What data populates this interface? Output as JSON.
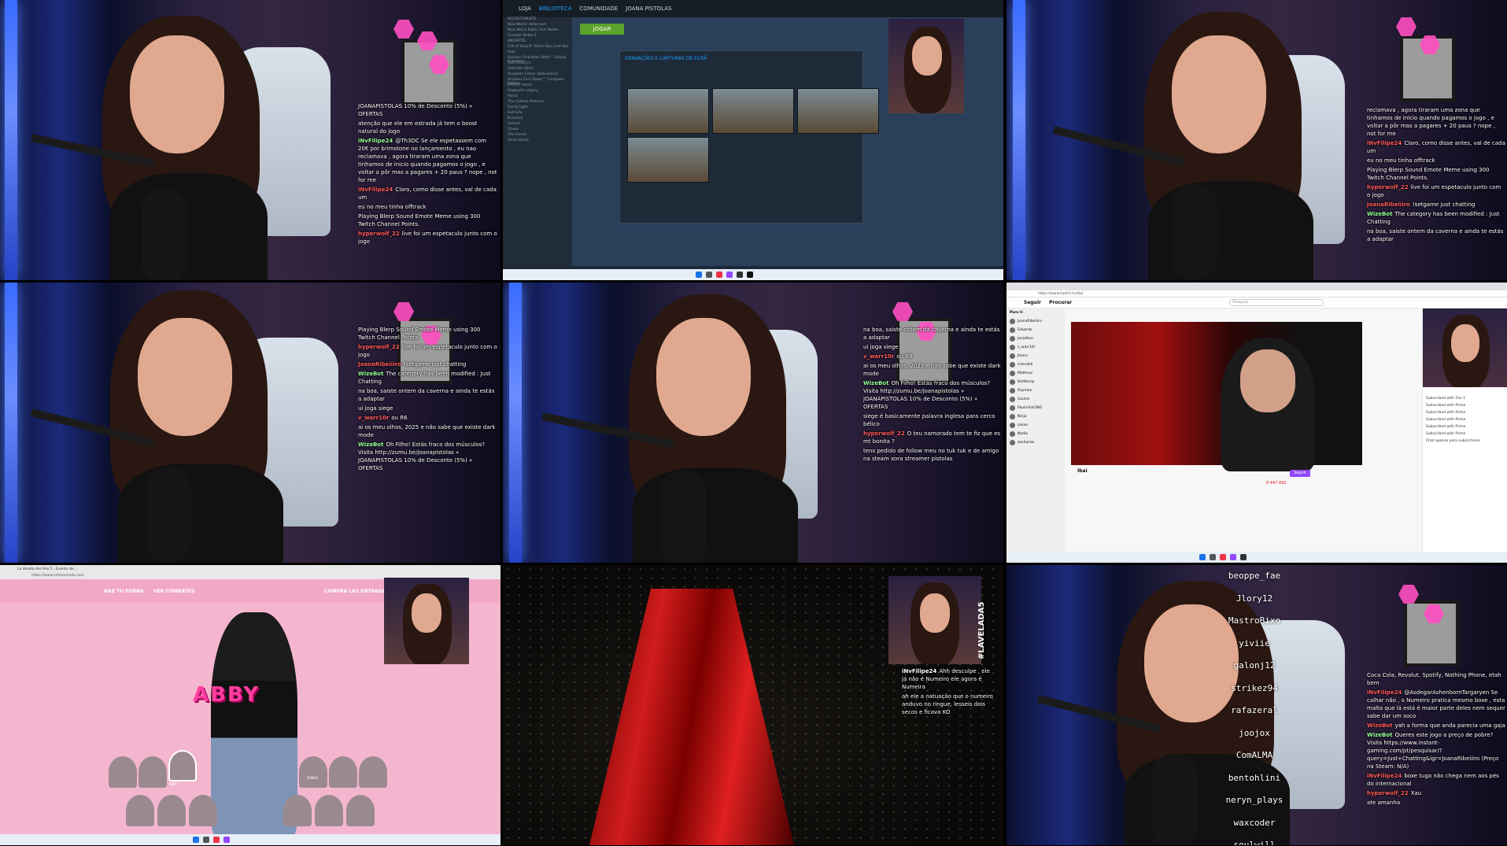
{
  "tile1": {
    "chat": [
      {
        "user": "",
        "text": "JOANAPISTOLAS 10% de Desconto (5%) » OFERTAS",
        "color": "#ffffff"
      },
      {
        "user": "",
        "text": "atenção que ele em estrada já tem o boost natural do jogo",
        "color": "#ff5a5a"
      },
      {
        "user": "iNvFilipe24",
        "text": "@Th3DC Se ele espetassem com 20€ por brimstone no lançamento , eu nao reclamava , agora tiraram uma zona que tinhamos de inicio quando pagamos o jogo , e voltar a pôr mas a pagares + 20 paus ? nope , not for me",
        "color": "#9aff9a"
      },
      {
        "user": "iNvFilipe24",
        "text": "Claro, como disse antes, val de cada um",
        "color": "#ff5a5a"
      },
      {
        "user": "",
        "text": "eu no meu tinha offtrack",
        "color": "#ff5a5a"
      },
      {
        "user": "",
        "text": "Playing Blerp Sound Emote Meme using 300 Twitch Channel Points.",
        "color": "#ff5a5a"
      },
      {
        "user": "hyperwolf_22",
        "text": "live foi um espetaculo junto com o jogo",
        "color": "#ff5a5a"
      }
    ]
  },
  "tile2": {
    "nav": [
      "LOJA",
      "BIBLIOTECA",
      "COMUNIDADE",
      "JOANA PISTOLAS"
    ],
    "play_label": "JOGAR",
    "dialog_title": "GRAVAÇÕES E CAPTURAS DE ECRÃ",
    "sidebar_items": [
      "RECENTEMENTE",
      "New World: Aeternum",
      "New World Public Test Realm",
      "Counter-Strike 2",
      "ANDARTEL",
      "Call of Duty®: Black Ops Cold War",
      "Halo",
      "Horizon Forbidden West™ Edição Complete",
      "Tom Clancy's",
      "Ultimate Ultim",
      "Kingdom Come: Deliverance",
      "Amazon Zero Dawn™ Complete Edition",
      "PAYDAY Home",
      "Hogwarts Legacy",
      "Portal",
      "The Callisto Protocol",
      "Dying Light",
      "Half-Life",
      "Bonanza",
      "Outlast",
      "Ocean",
      "The Forest",
      "Dead Island"
    ]
  },
  "tile3": {
    "chat": [
      {
        "user": "",
        "text": "reclamava , agora tiraram uma zona que tinhamos de inicio quando pagamos o jogo , e voltar a pôr mas a pagares + 20 paus ? nope , not for me",
        "color": "#ffffff"
      },
      {
        "user": "iNvFilipe24",
        "text": "Claro, como disse antes, val de cada um",
        "color": "#ff5a5a"
      },
      {
        "user": "",
        "text": "eu no meu tinha offtrack",
        "color": "#ff5a5a"
      },
      {
        "user": "",
        "text": "Playing Blerp Sound Emote Meme using 300 Twitch Channel Points.",
        "color": "#ff5a5a"
      },
      {
        "user": "hyperwolf_22",
        "text": "live foi um espetaculo junto com o jogo",
        "color": "#ff5a5a"
      },
      {
        "user": "JoanaRibeiiiro",
        "text": "!setgame just chatting",
        "color": "#ff5a5a"
      },
      {
        "user": "WizeBot",
        "text": "The category has been modified : Just Chatting",
        "color": "#9aff9a"
      },
      {
        "user": "",
        "text": "na boa, saiste ontem da caverna e ainda te estás a adaptar",
        "color": "#ff5a5a"
      }
    ]
  },
  "tile4": {
    "chat": [
      {
        "user": "",
        "text": "Playing Blerp Sound Emote Meme using 300 Twitch Channel Points.",
        "color": "#ff5a5a"
      },
      {
        "user": "hyperwolf_22",
        "text": "live foi um espetaculo junto com o jogo",
        "color": "#ff5a5a"
      },
      {
        "user": "JoanaRibeiiiro",
        "text": "!setgame just chatting",
        "color": "#ff5a5a"
      },
      {
        "user": "WizeBot",
        "text": "The category has been modified : Just Chatting",
        "color": "#9aff9a"
      },
      {
        "user": "",
        "text": "na boa, saiste ontem da caverna e ainda te estás a adaptar",
        "color": "#ff5a5a"
      },
      {
        "user": "",
        "text": "ui joga siege",
        "color": "#ff5a5a"
      },
      {
        "user": "v_warr10r",
        "text": "ou R6",
        "color": "#ff5a5a"
      },
      {
        "user": "",
        "text": "ai os meu olhos, 2025 e não sabe que existe dark mode",
        "color": "#ff5a5a"
      },
      {
        "user": "WizeBot",
        "text": "Oh Filho! Estás fraco dos músculos? Visita http://zumu.be/joanapistolas » JOANAPISTOLAS 10% de Desconto (5%) » OFERTAS",
        "color": "#9aff9a"
      }
    ]
  },
  "tile5": {
    "chat": [
      {
        "user": "",
        "text": "na boa, saiste ontem da caverna e ainda te estás a adaptar",
        "color": "#ff5a5a"
      },
      {
        "user": "",
        "text": "ui joga siege",
        "color": "#ff5a5a"
      },
      {
        "user": "v_warr10r",
        "text": "ou R6",
        "color": "#ff5a5a"
      },
      {
        "user": "",
        "text": "ai os meu olhos, 2025 e não sabe que existe dark mode",
        "color": "#ff5a5a"
      },
      {
        "user": "WizeBot",
        "text": "Oh Filho! Estás fraco dos músculos? Visita http://zumu.be/joanapistolas » JOANAPISTOLAS 10% de Desconto (5%) » OFERTAS",
        "color": "#9aff9a"
      },
      {
        "user": "",
        "text": "siege é basicamente palavra inglesa para cerco bélico",
        "color": "#ff5a5a"
      },
      {
        "user": "hyperwolf_22",
        "text": "O teu namorado tem te fiz que es mt bonita ?",
        "color": "#ff5a5a"
      },
      {
        "user": "",
        "text": "tens pedido de follow meu no tuk tuk e de amigo na steam xora streamer pistolas",
        "color": "#ff5a5a"
      }
    ]
  },
  "tile6": {
    "nav": [
      "Seguir",
      "Procurar"
    ],
    "search_placeholder": "Pesquisa",
    "follow_label": "Seguir",
    "streamer": "Ibai",
    "viewers": "8 447 092",
    "section_label": "Para ti",
    "channels": [
      "JoanaRibeiiiro",
      "Eduardo",
      "Jonathan",
      "v_warr10r",
      "Jhoira",
      "sirendell",
      "Matheus",
      "Bottlecap",
      "Rayman",
      "Gaules",
      "PaulinhoLOKO",
      "Ninja",
      "Lekan",
      "Nadia",
      "zacharias"
    ],
    "chat": [
      "Subscribed with Tier 1",
      "Subscribed with Prime",
      "Subscribed with Prime",
      "Subscribed with Prime",
      "Subscribed with Prime",
      "Subscribed with Prime",
      "Chat apenas para subscritores"
    ]
  },
  "tile7": {
    "tab": "La Velada del Año 5 - Evento de ...",
    "url": "https://www.infolavelada.com",
    "menu": [
      "HAZ TU PORRA",
      "VER COMBATES",
      "COMPRA LAS ENTRADAS"
    ],
    "fighter_name": "ABBY",
    "featured": [
      "ABBY",
      "ROBEO"
    ]
  },
  "tile8": {
    "overlay": "#LAVELADA5",
    "chat": [
      {
        "user": "iNvFilipe24",
        "text": "Ahh desculpe , ele já não é Numeiro ele agora é Numeira",
        "color": "#ffffff"
      },
      {
        "user": "",
        "text": "ah ele a natuação que o numeiro anduvo no ringue, lesseis dois secos e ficava KO",
        "color": "#ffffff"
      }
    ]
  },
  "tile9": {
    "names": [
      "beoppe_fae",
      "Jlory12",
      "MastroBixo",
      "yiviie",
      "galonj12",
      "strikez94",
      "rafazeral",
      "joojox",
      "ComALMA",
      "bentohlini",
      "neryn_plays",
      "waxcoder",
      "soulwill"
    ],
    "chat": [
      {
        "user": "",
        "text": "Coca Cola, Revolut, Spotify, Nothing Phone, etah bem",
        "color": "#ffffff"
      },
      {
        "user": "iNvFilipe24",
        "text": "@AsdegarAshenbornTargaryen Se calhar não , o Numeiro pratica mesmo boxe , esta malta que lá está é maior parte deles nem sequer sabe dar um soco",
        "color": "#ff5a5a"
      },
      {
        "user": "WizeBot",
        "text": "yah a forma que anda parecia uma gaja",
        "color": "#ff5a5a"
      },
      {
        "user": "WizeBot",
        "text": "Queres este jogo a preço de pobre? Visita https://www.instant-gaming.com/pt/pesquisar/?query=Just+Chatting&igr=JoanaRibeiiiro (Preço na Steam: N/A)",
        "color": "#9aff9a"
      },
      {
        "user": "iNvFilipe24",
        "text": "boxe tuga não chega nem aos pés do internacional",
        "color": "#ff5a5a"
      },
      {
        "user": "hyperwolf_22",
        "text": "Xau",
        "color": "#ff5a5a"
      },
      {
        "user": "",
        "text": "ate amanha",
        "color": "#ff5a5a"
      }
    ]
  }
}
